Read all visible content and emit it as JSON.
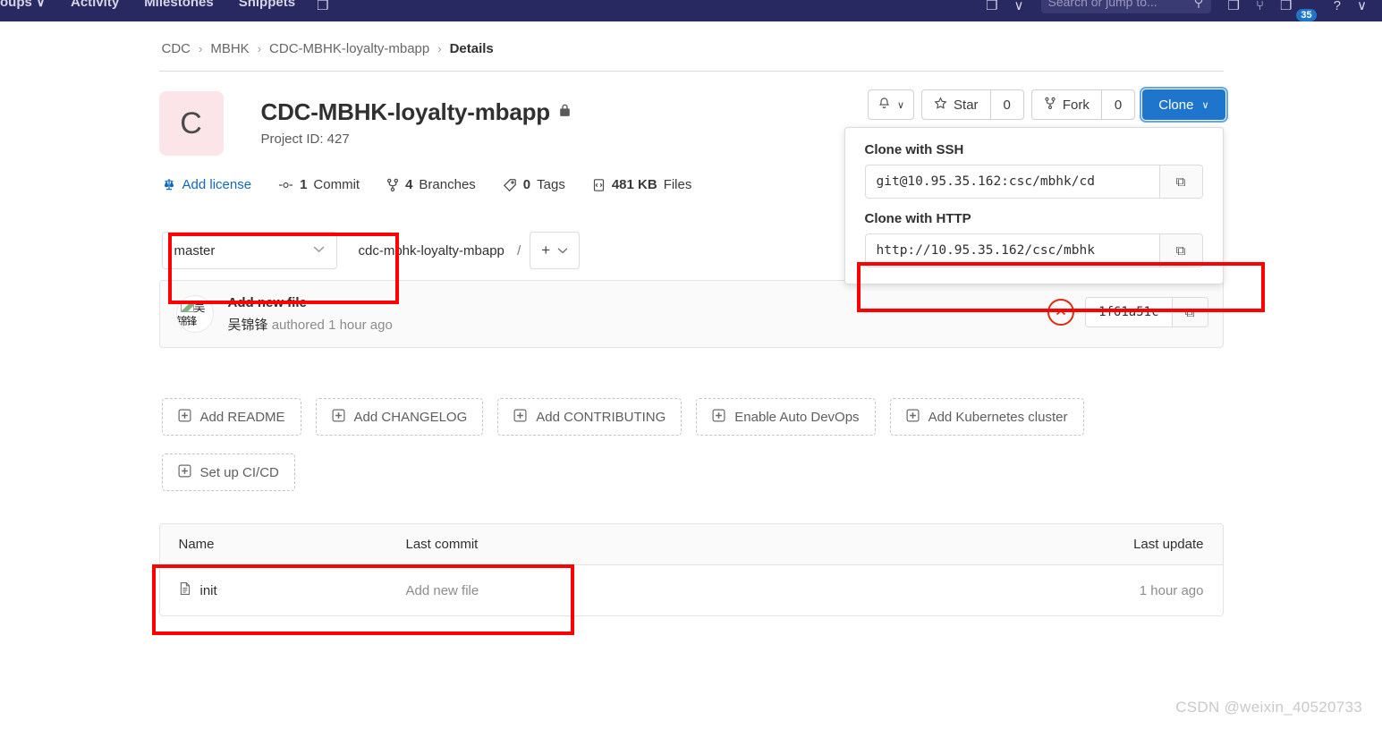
{
  "topnav": {
    "left_items": [
      "oups",
      "Activity",
      "Milestones",
      "Snippets"
    ],
    "groups_caret": "∨",
    "board_icon": "❐",
    "search_placeholder": "Search or jump to...",
    "search_icon": "⚲",
    "issues_icon": "❐",
    "merge_icon": "⑂",
    "todos_icon": "❐",
    "todos_count": "35",
    "help_icon": "?",
    "help_caret": "∨"
  },
  "breadcrumb": {
    "items": [
      "CDC",
      "MBHK",
      "CDC-MBHK-loyalty-mbapp"
    ],
    "current": "Details",
    "separator": "›"
  },
  "project": {
    "avatar_letter": "C",
    "title": "CDC-MBHK-loyalty-mbapp",
    "visibility_icon": "🔒",
    "project_id": "Project ID: 427",
    "stats": [
      {
        "name": "add-license",
        "label": "Add license",
        "value": "",
        "link": true
      },
      {
        "name": "commits",
        "label": "Commit",
        "value": "1",
        "link": false
      },
      {
        "name": "branches",
        "label": "Branches",
        "value": "4",
        "link": false
      },
      {
        "name": "tags",
        "label": "Tags",
        "value": "0",
        "link": false
      },
      {
        "name": "files",
        "label": "Files",
        "value": "481 KB",
        "link": false
      }
    ]
  },
  "actions": {
    "notification_icon": "⌷",
    "notification_caret": "∨",
    "star_label": "Star",
    "star_count": "0",
    "fork_label": "Fork",
    "fork_count": "0",
    "clone_label": "Clone",
    "clone_caret": "∨"
  },
  "clone_popup": {
    "ssh_label": "Clone with SSH",
    "ssh_url": "git@10.95.35.162:csc/mbhk/cd",
    "http_label": "Clone with HTTP",
    "http_url": "http://10.95.35.162/csc/mbhk",
    "copy_icon": "⧉"
  },
  "branch_bar": {
    "branch": "master",
    "caret": "∨",
    "repo_path": "cdc-mbhk-loyalty-mbapp",
    "slash": "/",
    "plus": "+",
    "plus_caret": "∨"
  },
  "last_commit": {
    "avatar_text_top": "吴",
    "avatar_text_bottom": "锦锋",
    "title": "Add new file",
    "author": "吴锦锋",
    "meta": "authored 1 hour ago",
    "status_icon": "⌃",
    "hash": "1f61a51c",
    "copy_icon": "⧉"
  },
  "quick_actions": [
    {
      "name": "add-readme",
      "label": "Add README"
    },
    {
      "name": "add-changelog",
      "label": "Add CHANGELOG"
    },
    {
      "name": "add-contributing",
      "label": "Add CONTRIBUTING"
    },
    {
      "name": "enable-auto-devops",
      "label": "Enable Auto DevOps"
    },
    {
      "name": "add-kubernetes-cluster",
      "label": "Add Kubernetes cluster"
    },
    {
      "name": "set-up-ci-cd",
      "label": "Set up CI/CD"
    }
  ],
  "file_table": {
    "headers": {
      "name": "Name",
      "last_commit": "Last commit",
      "last_update": "Last update"
    },
    "rows": [
      {
        "name": "init",
        "last_commit": "Add new file",
        "last_update": "1 hour ago"
      }
    ]
  },
  "watermark": "CSDN @weixin_40520733",
  "colors": {
    "nav_bg": "#292961",
    "accent_blue": "#1f75cb",
    "link_blue": "#1068bf",
    "annotation_red": "#ff0000",
    "avatar_bg": "#fbe5e8",
    "status_red": "#dd2b0e"
  }
}
